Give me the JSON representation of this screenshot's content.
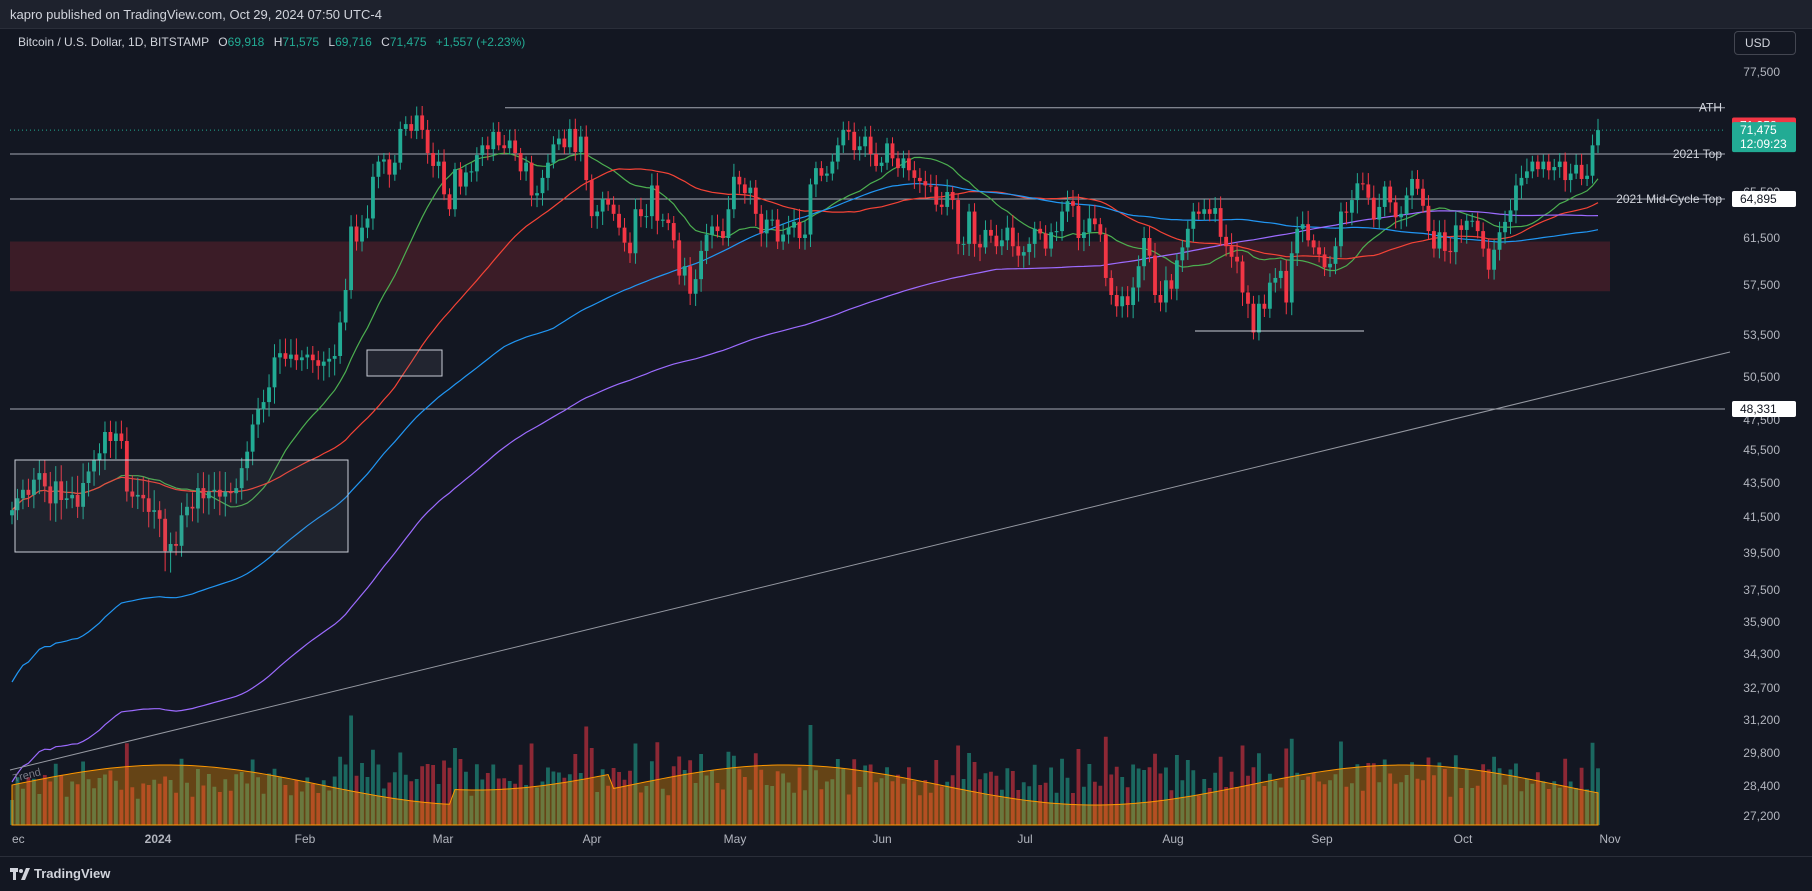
{
  "header": {
    "publisher_text": "kapro published on TradingView.com, Oct 29, 2024 07:50 UTC-4"
  },
  "legend": {
    "symbol": "Bitcoin / U.S. Dollar, 1D, BITSTAMP",
    "open_label": "O",
    "open": "69,918",
    "high_label": "H",
    "high": "71,575",
    "low_label": "L",
    "low": "69,716",
    "close_label": "C",
    "close": "71,475",
    "change": "+1,557 (+2.23%)"
  },
  "currency_button": "USD",
  "footer": {
    "brand": "TradingView"
  },
  "colors": {
    "background": "#131722",
    "up": "#22ab94",
    "down": "#f23645",
    "ma_fast": "#4caf50",
    "ma_mid": "#f44336",
    "ma_slow": "#2196f3",
    "ma_long": "#9c6bff"
  },
  "chart_data": {
    "type": "candlestick",
    "symbol": "Bitcoin / U.S. Dollar",
    "interval": "1D",
    "exchange": "BITSTAMP",
    "x_labels": [
      "ec",
      "2024",
      "Feb",
      "Mar",
      "Apr",
      "May",
      "Jun",
      "Jul",
      "Aug",
      "Sep",
      "Oct",
      "Nov"
    ],
    "y_ticks": [
      "77,500",
      "65,500",
      "61,500",
      "57,500",
      "53,500",
      "50,500",
      "47,500",
      "45,500",
      "43,500",
      "41,500",
      "39,500",
      "37,500",
      "35,900",
      "34,300",
      "32,700",
      "31,200",
      "29,800",
      "28,400",
      "27,200"
    ],
    "price_badges": [
      {
        "label": "71,958",
        "value": 71958,
        "color": "#f23645"
      },
      {
        "label": "71,475",
        "value": 71475,
        "color": "#22ab94",
        "countdown": "12:09:23"
      },
      {
        "label": "64,895",
        "value": 64895,
        "color": "#ffffff"
      },
      {
        "label": "48,331",
        "value": 48331,
        "color": "#ffffff"
      }
    ],
    "levels": [
      {
        "label": "ATH",
        "value": 73800
      },
      {
        "label": "2021 Top",
        "value": 69000
      },
      {
        "label": "2021 Mid-Cycle Top",
        "value": 64895
      },
      {
        "label": "",
        "value": 48331
      }
    ],
    "zone": {
      "from": 57000,
      "to": 61200
    },
    "trend_label": "Trend",
    "closes": [
      41900,
      42600,
      43100,
      42800,
      43700,
      44100,
      43300,
      42300,
      43600,
      42500,
      42600,
      42800,
      42100,
      43500,
      44200,
      44900,
      45300,
      46700,
      46100,
      46600,
      46100,
      43000,
      42700,
      42800,
      42600,
      41800,
      41900,
      41400,
      39600,
      40000,
      39900,
      41600,
      42100,
      42000,
      43200,
      42600,
      43000,
      43100,
      42700,
      43000,
      42900,
      43200,
      44400,
      45400,
      47200,
      48300,
      48800,
      49800,
      51900,
      52200,
      51800,
      52100,
      51700,
      51900,
      52100,
      51700,
      51300,
      51600,
      51800,
      52000,
      54500,
      57100,
      62500,
      61200,
      62400,
      63200,
      66900,
      68300,
      68500,
      67100,
      68200,
      71600,
      72100,
      71400,
      73000,
      71500,
      69100,
      67900,
      68300,
      65300,
      64000,
      67600,
      66000,
      67300,
      67400,
      68900,
      69900,
      69500,
      71300,
      69900,
      69600,
      70400,
      69100,
      67400,
      68200,
      65200,
      65400,
      66800,
      68200,
      70000,
      70600,
      69700,
      71600,
      69200,
      70800,
      66600,
      63400,
      63800,
      64900,
      64400,
      63600,
      62400,
      61100,
      60200,
      64000,
      63400,
      63400,
      66100,
      63000,
      63100,
      62800,
      61300,
      58300,
      59100,
      56800,
      58000,
      60400,
      61800,
      62500,
      62100,
      61500,
      64000,
      66900,
      66200,
      65400,
      65900,
      63600,
      61900,
      63100,
      63100,
      61200,
      61800,
      62400,
      62900,
      61500,
      61800,
      66200,
      67700,
      67000,
      67200,
      68300,
      69900,
      71500,
      71300,
      69400,
      69800,
      70800,
      69000,
      67900,
      68200,
      70100,
      68600,
      67700,
      68600,
      67500,
      66800,
      66500,
      66100,
      66000,
      64400,
      64200,
      65500,
      64800,
      61000,
      61000,
      63800,
      61000,
      60700,
      62200,
      61700,
      60800,
      61300,
      62400,
      60800,
      60000,
      60300,
      61000,
      62300,
      61900,
      60600,
      62000,
      62100,
      63800,
      64700,
      64300,
      61500,
      62000,
      63200,
      62700,
      61800,
      58100,
      56700,
      55800,
      56600,
      55900,
      57300,
      59100,
      61500,
      60000,
      56700,
      56100,
      57900,
      57200,
      59600,
      60700,
      62300,
      63800,
      63600,
      64000,
      63600,
      64100,
      61600,
      60800,
      59900,
      59500,
      56900,
      56000,
      53700,
      56000,
      55600,
      57700,
      58100,
      58700,
      56100,
      60200,
      62300,
      62700,
      61300,
      60700,
      60100,
      59000,
      59300,
      60800,
      63800,
      63700,
      64800,
      66300,
      66200,
      65000,
      63100,
      64200,
      66000,
      64600,
      63300,
      63600,
      65200,
      66700,
      65800,
      64300,
      62100,
      60600,
      62000,
      60400,
      60300,
      62600,
      62200,
      63000,
      63000,
      62100,
      60600,
      58800,
      60500,
      62000,
      62900,
      63900,
      66100,
      66800,
      67400,
      68300,
      67600,
      68300,
      67500,
      67800,
      68300,
      66600,
      67200,
      68000,
      66700,
      67000,
      69900,
      71475
    ]
  }
}
